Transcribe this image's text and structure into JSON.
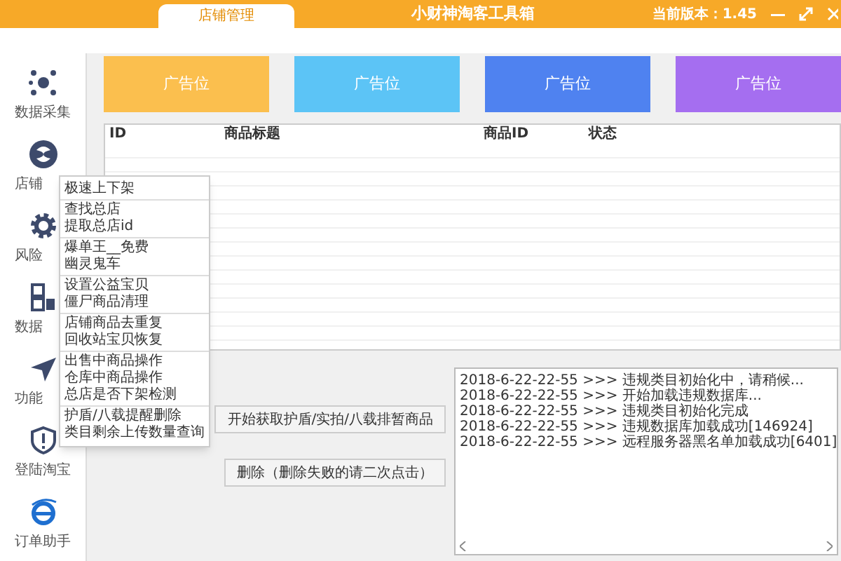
{
  "window": {
    "title": "小财神淘客工具箱",
    "version": "当前版本：1.45"
  },
  "tabs": [
    {
      "label": "店铺管理",
      "selected": true
    }
  ],
  "sidebar": {
    "items": [
      {
        "label": "数据采集",
        "kind": "dots"
      },
      {
        "label": "店铺",
        "kind": "swirl"
      },
      {
        "label": "风险",
        "kind": "gear"
      },
      {
        "label": "数据",
        "kind": "squares"
      },
      {
        "label": "功能",
        "kind": "plane"
      },
      {
        "label": "登陆淘宝",
        "kind": "shield"
      },
      {
        "label": "订单助手",
        "kind": "browser"
      }
    ]
  },
  "ads": [
    {
      "label": "广告位",
      "color": "#fbbf4e"
    },
    {
      "label": "广告位",
      "color": "#5cc4f6"
    },
    {
      "label": "广告位",
      "color": "#4f82f0"
    },
    {
      "label": "广告位",
      "color": "#a56ef0"
    }
  ],
  "table": {
    "columns": [
      "ID",
      "商品标题",
      "商品ID",
      "状态"
    ]
  },
  "buttons": [
    "开始获取护盾/实拍/八载排暂商品",
    "删除（删除失败的请二次点击）"
  ],
  "log": [
    "2018-6-22-22-55 >>> 违规类目初始化中，请稍候...",
    "2018-6-22-22-55 >>> 开始加载违规数据库...",
    "2018-6-22-22-55 >>> 违规类目初始化完成",
    "2018-6-22-22-55 >>> 违规数据库加载成功[146924]",
    "2018-6-22-22-55 >>> 远程服务器黑名单加载成功[6401]"
  ],
  "context_menu": {
    "groups": [
      [
        "极速上下架"
      ],
      [
        "查找总店",
        "提取总店id"
      ],
      [
        "爆单王__免费",
        "幽灵鬼车"
      ],
      [
        "设置公益宝贝",
        "僵尸商品清理"
      ],
      [
        "店铺商品去重复",
        "回收站宝贝恢复"
      ],
      [
        "出售中商品操作",
        "仓库中商品操作",
        "总店是否下架检测"
      ],
      [
        "护盾/八载提醒删除",
        "类目剩余上传数量查询"
      ]
    ]
  }
}
